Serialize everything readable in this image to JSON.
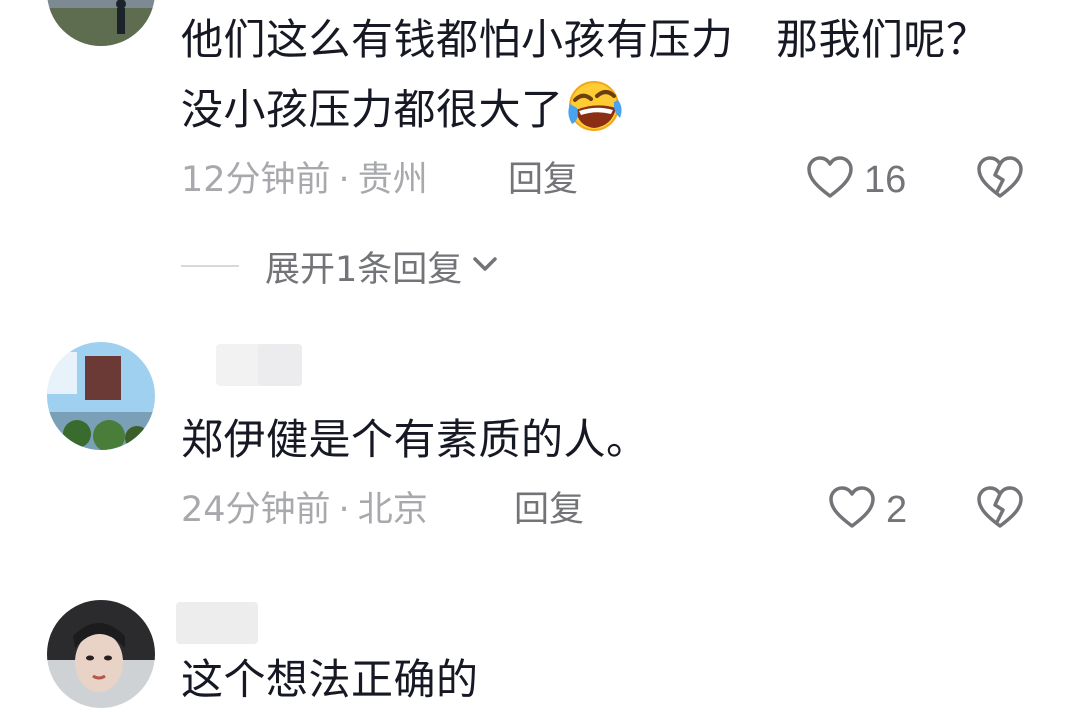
{
  "comments": [
    {
      "text_lines": [
        "他们这么有钱都怕小孩有压力　那我们呢？",
        "没小孩压力都很大了"
      ],
      "emoji": "rolling-on-floor-laughing-emoji",
      "time": "12分钟前",
      "dot": "·",
      "location": "贵州",
      "reply": "回复",
      "likes": "16",
      "expand": "展开1条回复"
    },
    {
      "text_lines": [
        "郑伊健是个有素质的人。"
      ],
      "time": "24分钟前",
      "dot": "·",
      "location": "北京",
      "reply": "回复",
      "likes": "2"
    },
    {
      "text_lines": [
        "这个想法正确的"
      ]
    }
  ],
  "colors": {
    "text": "#161823",
    "meta": "#a8a9ad",
    "action": "#737478"
  }
}
